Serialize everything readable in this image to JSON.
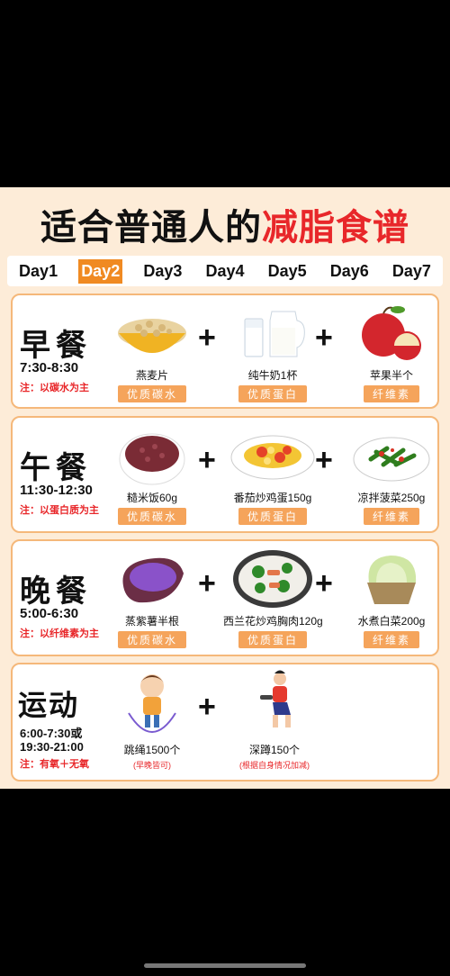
{
  "title": {
    "part1": "适合普通人的",
    "part2": "减脂食谱"
  },
  "days": [
    "Day1",
    "Day2",
    "Day3",
    "Day4",
    "Day5",
    "Day6",
    "Day7"
  ],
  "active_day": "Day2",
  "meals": [
    {
      "name": "早餐",
      "time": "7:30-8:30",
      "note": "注：以碳水为主",
      "items": [
        {
          "name": "燕麦片",
          "tag": "优质碳水",
          "icon": "oats-icon"
        },
        {
          "name": "纯牛奶1杯",
          "tag": "优质蛋白",
          "icon": "milk-icon"
        },
        {
          "name": "苹果半个",
          "tag": "纤维素",
          "icon": "apple-icon"
        }
      ]
    },
    {
      "name": "午餐",
      "time": "11:30-12:30",
      "note": "注：以蛋白质为主",
      "items": [
        {
          "name": "糙米饭60g",
          "tag": "优质碳水",
          "icon": "brown-rice-icon"
        },
        {
          "name": "番茄炒鸡蛋150g",
          "tag": "优质蛋白",
          "icon": "tomato-egg-icon"
        },
        {
          "name": "凉拌菠菜250g",
          "tag": "纤维素",
          "icon": "spinach-icon"
        }
      ]
    },
    {
      "name": "晚餐",
      "time": "5:00-6:30",
      "note": "注：以纤维素为主",
      "items": [
        {
          "name": "蒸紫薯半根",
          "tag": "优质碳水",
          "icon": "purple-potato-icon"
        },
        {
          "name": "西兰花炒鸡胸肉120g",
          "tag": "优质蛋白",
          "icon": "broccoli-chicken-icon"
        },
        {
          "name": "水煮白菜200g",
          "tag": "纤维素",
          "icon": "cabbage-icon"
        }
      ]
    }
  ],
  "exercise": {
    "name": "运动",
    "time1": "6:00-7:30或",
    "time2": "19:30-21:00",
    "note": "注：有氧＋无氧",
    "items": [
      {
        "name": "跳绳1500个",
        "sub": "(早晚皆可)",
        "icon": "jump-rope-icon"
      },
      {
        "name": "深蹲150个",
        "sub": "(根据自身情况加减)",
        "icon": "squat-icon"
      }
    ]
  },
  "plus": "+",
  "colors": {
    "accent": "#f08a22",
    "red": "#e8272a",
    "tag": "#f5a45b",
    "border": "#f5b87a",
    "bg": "#fdecd8"
  }
}
